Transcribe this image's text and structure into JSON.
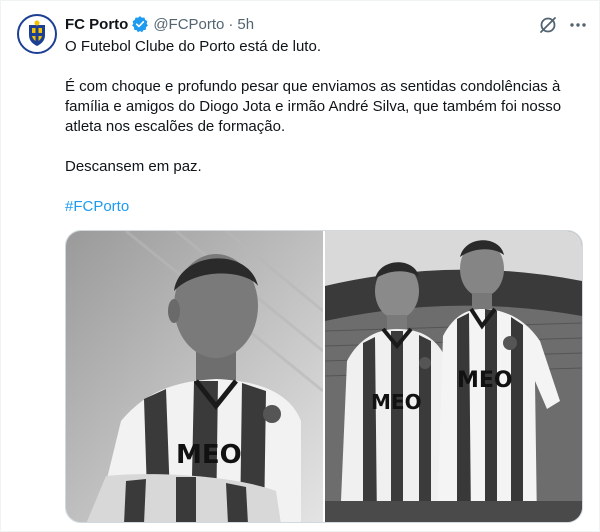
{
  "tweet": {
    "display_name": "FC Porto",
    "handle": "@FCPorto",
    "separator": "·",
    "time": "5h",
    "paragraphs": [
      "O Futebol Clube do Porto está de luto.",
      "É com choque e profundo pesar que enviamos as sentidas condolências à família e amigos do Diogo Jota e irmão André Silva, que também foi nosso atleta nos escalões de formação.",
      "Descansem em paz."
    ],
    "hashtag": "#FCPorto",
    "shirt_sponsor": "MEO"
  },
  "colors": {
    "link": "#1d9bf0",
    "verified": "#1d9bf0",
    "secondary_text": "#536471",
    "club_blue": "#1c3f94"
  },
  "icons": {
    "verified": "verified-badge-icon",
    "grok": "grok-icon",
    "more": "more-icon"
  }
}
